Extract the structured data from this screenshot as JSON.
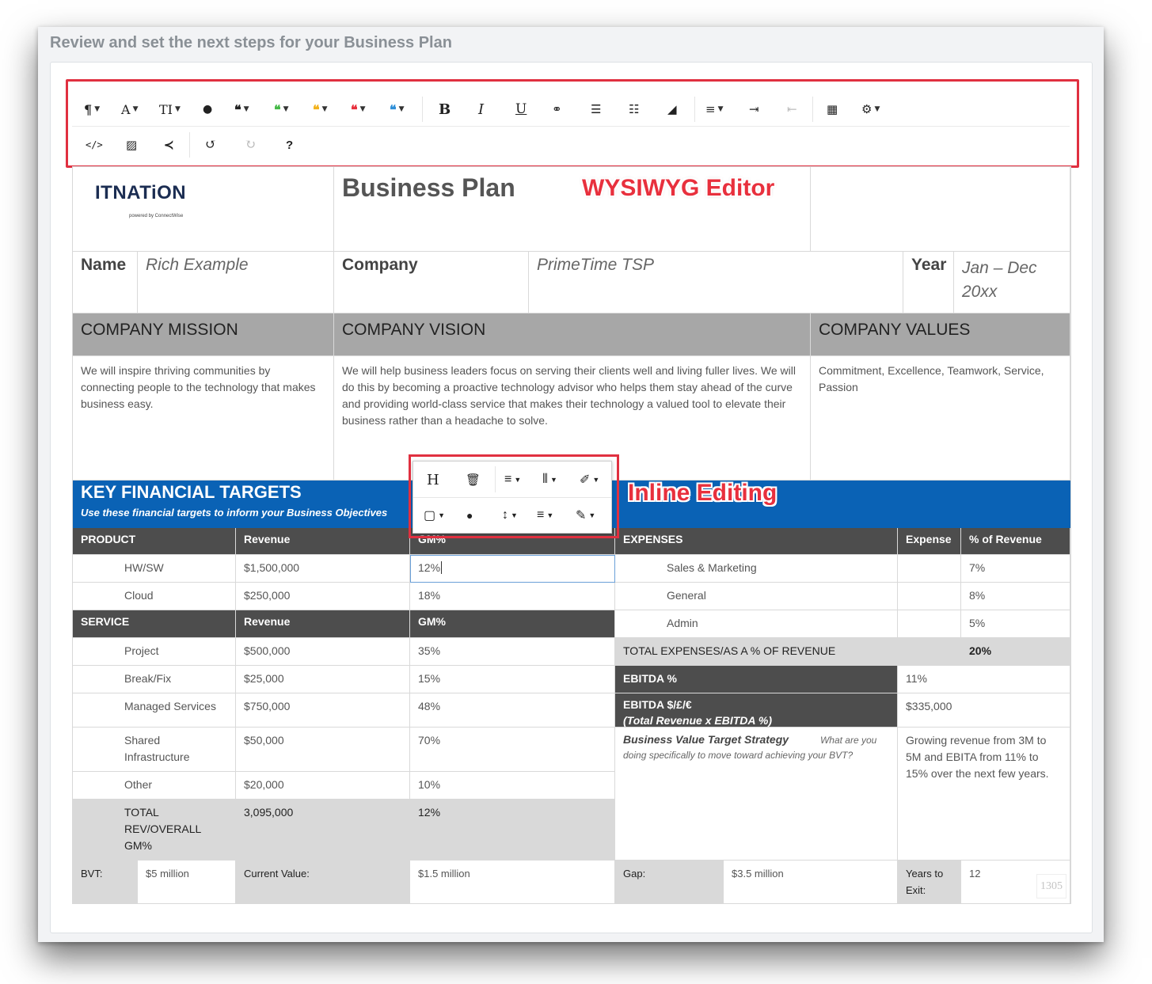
{
  "page": {
    "heading": "Review and set the next steps for your Business Plan"
  },
  "toolbar": {
    "row1": [
      {
        "icon": "paragraph-icon",
        "glyph": "¶",
        "caret": true
      },
      {
        "icon": "font-icon",
        "glyph": "A",
        "caret": true
      },
      {
        "icon": "font-size-icon",
        "glyph": "TI",
        "caret": true
      },
      {
        "icon": "color-drop-icon",
        "glyph": "🌢",
        "caret": false
      },
      {
        "icon": "quote-icon",
        "glyph": "❝",
        "caret": true
      },
      {
        "icon": "quote-green-icon",
        "glyph": "❝",
        "caret": true
      },
      {
        "icon": "quote-yellow-icon",
        "glyph": "❝",
        "caret": true
      },
      {
        "icon": "quote-red-icon",
        "glyph": "❝",
        "caret": true
      },
      {
        "icon": "quote-blue-icon",
        "glyph": "❝",
        "caret": true
      },
      {
        "icon": "bold-icon",
        "glyph": "B",
        "caret": false
      },
      {
        "icon": "italic-icon",
        "glyph": "I",
        "caret": false
      },
      {
        "icon": "underline-icon",
        "glyph": "U",
        "caret": false
      },
      {
        "icon": "link-icon",
        "glyph": "🔗",
        "caret": false
      },
      {
        "icon": "bullet-list-icon",
        "glyph": "☰",
        "caret": false
      },
      {
        "icon": "numbered-list-icon",
        "glyph": "☷",
        "caret": false
      },
      {
        "icon": "eraser-icon",
        "glyph": "⌫",
        "caret": false
      },
      {
        "icon": "align-icon",
        "glyph": "≡",
        "caret": true
      },
      {
        "icon": "indent-icon",
        "glyph": "⇥",
        "caret": false
      },
      {
        "icon": "outdent-icon",
        "glyph": "⇤",
        "caret": false
      },
      {
        "icon": "table-icon",
        "glyph": "▦",
        "caret": false
      },
      {
        "icon": "settings-icon",
        "glyph": "⚙",
        "caret": true
      }
    ],
    "row2": [
      {
        "icon": "code-view-icon",
        "glyph": "</>"
      },
      {
        "icon": "image-icon",
        "glyph": "▨"
      },
      {
        "icon": "share-icon",
        "glyph": "<"
      },
      {
        "icon": "undo-icon",
        "glyph": "↺"
      },
      {
        "icon": "redo-icon",
        "glyph": "↻"
      },
      {
        "icon": "help-icon",
        "glyph": "?"
      }
    ],
    "colors": {
      "green": "#44b947",
      "yellow": "#f2b21c",
      "red": "#e8303d",
      "blue": "#2f8fd8"
    }
  },
  "labels": {
    "wysiwyg": "WYSIWYG Editor",
    "inline": "Inline Editing"
  },
  "logo": {
    "text": "ITNATiON",
    "sub": "powered by ConnectWise"
  },
  "doc": {
    "title": "Business Plan",
    "name_label": "Name",
    "name_value": "Rich Example",
    "company_label": "Company",
    "company_value": "PrimeTime TSP",
    "year_label": "Year",
    "year_value": "Jan – Dec 20xx",
    "mission_h": "COMPANY MISSION",
    "vision_h": "COMPANY VISION",
    "values_h": "COMPANY VALUES",
    "mission": "We will inspire thriving communities by connecting people to the technology that makes business easy.",
    "vision": "We will help business leaders focus on serving their clients well and living fuller lives.  We will do this by becoming a proactive technology advisor who helps them stay ahead of the curve and providing world-class service that makes their technology a valued tool to elevate their business rather than a headache to solve.",
    "values": "Commitment, Excellence, Teamwork, Service, Passion",
    "kft_title": "KEY FINANCIAL TARGETS",
    "kft_sub": "Use these financial targets to inform your Business Objectives",
    "product_h": "PRODUCT",
    "revenue_h": "Revenue",
    "gm_h": "GM%",
    "products": [
      {
        "name": "HW/SW",
        "rev": "$1,500,000",
        "gm": "12%"
      },
      {
        "name": "Cloud",
        "rev": "$250,000",
        "gm": "18%"
      }
    ],
    "service_h": "SERVICE",
    "services": [
      {
        "name": "Project",
        "rev": "$500,000",
        "gm": "35%"
      },
      {
        "name": "Break/Fix",
        "rev": "$25,000",
        "gm": "15%"
      },
      {
        "name": "Managed Services",
        "rev": "$750,000",
        "gm": "48%"
      },
      {
        "name": "Shared Infrastructure",
        "rev": "$50,000",
        "gm": "70%"
      },
      {
        "name": "Other",
        "rev": "$20,000",
        "gm": "10%"
      }
    ],
    "total_label": "TOTAL REV/OVERALL GM%",
    "total_rev": "3,095,000",
    "total_gm": "12%",
    "expenses_h": "EXPENSES",
    "expense_h": "Expense",
    "pct_rev_h": "% of Revenue",
    "expenses": [
      {
        "name": "Sales & Marketing",
        "pct": "7%"
      },
      {
        "name": "General",
        "pct": "8%"
      },
      {
        "name": "Admin",
        "pct": "5%"
      }
    ],
    "total_exp_label": "TOTAL EXPENSES/AS A % OF REVENUE",
    "total_exp_pct": "20%",
    "ebitda_pct_label": "EBITDA %",
    "ebitda_pct": "11%",
    "ebitda_dollar_label": "EBITDA $/£/€",
    "ebitda_dollar_sub": "(Total Revenue x EBITDA %)",
    "ebitda_dollar": "$335,000",
    "bvt_strategy_label": "Business Value Target Strategy",
    "bvt_strategy_q": "What are you doing specifically to move toward achieving your BVT?",
    "bvt_strategy_value": "Growing revenue from 3M to 5M and EBITA from 11% to 15% over the next few years.",
    "bvt_label": "BVT:",
    "bvt_value": "$5 million",
    "current_label": "Current Value:",
    "current_value": "$1.5 million",
    "gap_label": "Gap:",
    "gap_value": "$3.5 million",
    "years_label": "Years to Exit:",
    "years_value": "12",
    "page_number": "1305"
  },
  "inline_toolbar": {
    "row1": [
      "H",
      "🗑",
      "≡",
      "|||",
      "🖌"
    ],
    "row2": [
      "□",
      "🌢",
      "↕",
      "≡",
      "✎"
    ]
  }
}
